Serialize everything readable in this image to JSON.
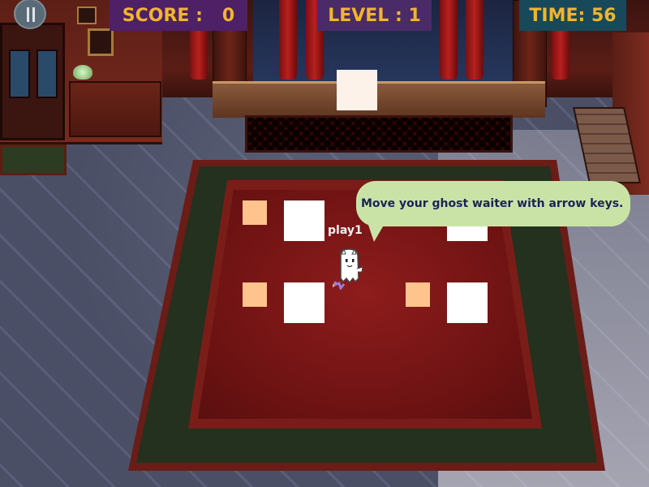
{
  "hud": {
    "score_label": "SCORE :",
    "score_value": "0",
    "level_label": "LEVEL : 1",
    "time_label": "TIME: 56"
  },
  "player": {
    "name": "play1"
  },
  "tutorial": {
    "message": "Move your ghost waiter with arrow keys."
  },
  "icons": {
    "pause": "pause-icon",
    "ghost": "ghost-waiter-icon"
  },
  "colors": {
    "hud_text": "#f2b52c",
    "score_bg": "#4e2066",
    "level_bg": "#4a2b68",
    "time_bg": "#17495a",
    "bubble_bg": "#c9e3a7",
    "bubble_text": "#1a2355",
    "table": "#ffffff",
    "chair": "#ffc48e",
    "carpet_red": "#8e1c1c",
    "carpet_green": "#23311e"
  }
}
